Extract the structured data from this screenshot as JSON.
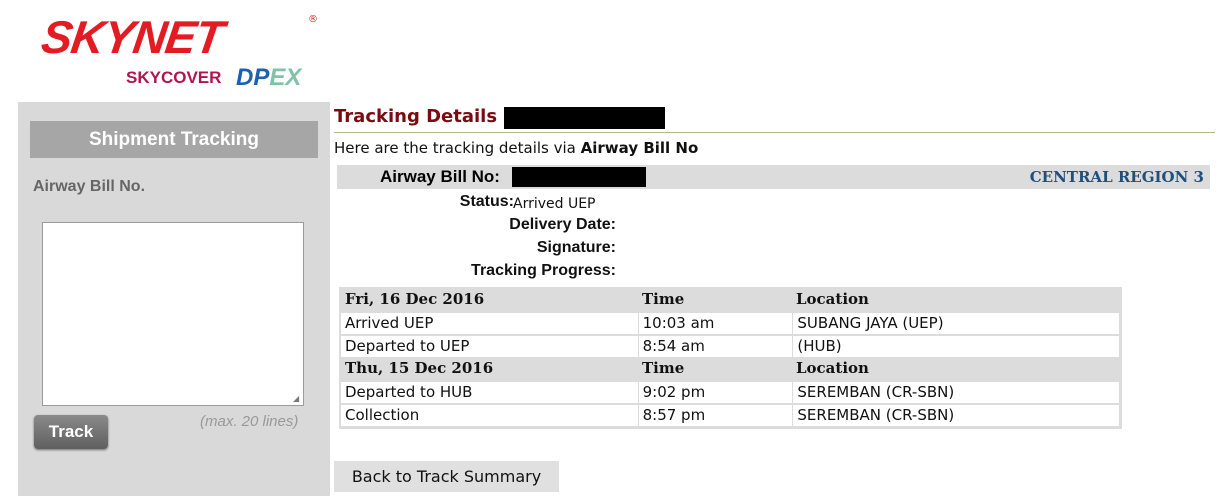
{
  "logo": {
    "main": "SKYNET",
    "registered": "®",
    "sub_skycover": "SKYCOVER",
    "sub_dpex_dp": "DP",
    "sub_dpex_ex": "EX"
  },
  "sidebar": {
    "title": "Shipment Tracking",
    "airway_label": "Airway Bill No.",
    "textarea_value": "",
    "track_button": "Track",
    "max_hint": "(max. 20 lines)"
  },
  "main": {
    "heading": "Tracking Details -",
    "intro_prefix": "Here are the tracking details via",
    "intro_bold": "Airway Bill No",
    "awb_label": "Airway Bill No:",
    "region": "CENTRAL REGION 3",
    "info": {
      "status_label": "Status:",
      "status_value": "Arrived UEP",
      "delivery_label": "Delivery Date:",
      "delivery_value": "",
      "signature_label": "Signature:",
      "signature_value": "",
      "progress_label": "Tracking Progress:"
    },
    "groups": [
      {
        "date": "Fri, 16 Dec 2016",
        "time_header": "Time",
        "location_header": "Location",
        "rows": [
          {
            "event": "Arrived UEP",
            "time": "10:03 am",
            "location": "SUBANG JAYA (UEP)"
          },
          {
            "event": "Departed to UEP",
            "time": "8:54 am",
            "location": "(HUB)"
          }
        ]
      },
      {
        "date": "Thu, 15 Dec 2016",
        "time_header": "Time",
        "location_header": "Location",
        "rows": [
          {
            "event": "Departed to HUB",
            "time": "9:02 pm",
            "location": "SEREMBAN (CR-SBN)"
          },
          {
            "event": "Collection",
            "time": "8:57 pm",
            "location": "SEREMBAN (CR-SBN)"
          }
        ]
      }
    ],
    "back_button": "Back to Track Summary"
  },
  "colors": {
    "brand_red": "#e31b23",
    "heading_maroon": "#7a0b12",
    "region_blue": "#1f4f7a",
    "panel_gray": "#d9d9d9"
  }
}
